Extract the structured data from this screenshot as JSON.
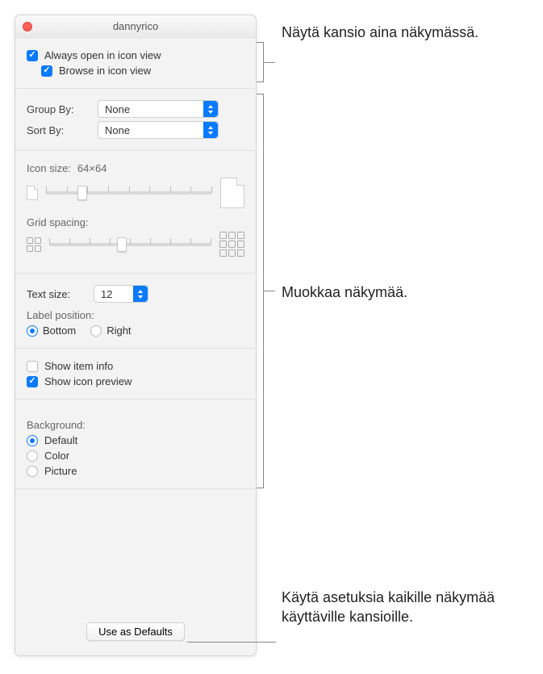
{
  "window": {
    "title": "dannyrico"
  },
  "view_options": {
    "always_open_label": "Always open in icon view",
    "always_open_checked": true,
    "browse_label": "Browse in icon view",
    "browse_checked": true
  },
  "arrange": {
    "group_by_label": "Group By:",
    "group_by_value": "None",
    "sort_by_label": "Sort By:",
    "sort_by_value": "None"
  },
  "icon": {
    "size_label": "Icon size:",
    "size_value": "64×64",
    "size_slider_pct": 22,
    "grid_label": "Grid spacing:",
    "grid_slider_pct": 45
  },
  "text": {
    "size_label": "Text size:",
    "size_value": "12",
    "position_label": "Label position:",
    "bottom_label": "Bottom",
    "right_label": "Right",
    "selected": "bottom"
  },
  "info": {
    "show_item_info_label": "Show item info",
    "show_item_info_checked": false,
    "show_preview_label": "Show icon preview",
    "show_preview_checked": true
  },
  "background": {
    "label": "Background:",
    "default_label": "Default",
    "color_label": "Color",
    "picture_label": "Picture",
    "selected": "default"
  },
  "defaults_button": "Use as Defaults",
  "annotations": {
    "top": "Näytä kansio aina näkymässä.",
    "middle": "Muokkaa näkymää.",
    "bottom": "Käytä asetuksia kaikille näkymää käyttäville kansioille."
  }
}
